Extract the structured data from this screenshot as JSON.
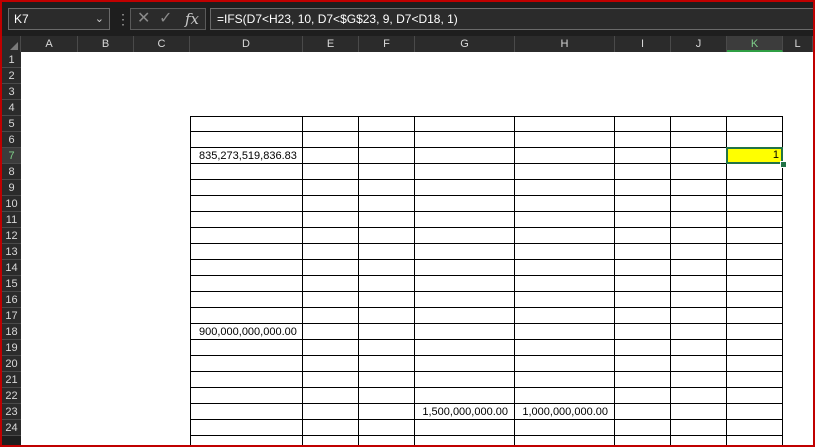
{
  "name_box": {
    "value": "K7",
    "dropdown_icon": "chevron-down-icon"
  },
  "formula_bar": {
    "cancel_icon": "cancel-x-icon",
    "enter_icon": "checkmark-icon",
    "fx_label": "fx",
    "formula": "=IFS(D7<H23, 10, D7<$G$23, 9, D7<D18, 1)"
  },
  "columns": [
    "A",
    "B",
    "C",
    "D",
    "E",
    "F",
    "G",
    "H",
    "I",
    "J",
    "K",
    "L"
  ],
  "rows": [
    "1",
    "2",
    "3",
    "4",
    "5",
    "6",
    "7",
    "8",
    "9",
    "10",
    "11",
    "12",
    "13",
    "14",
    "15",
    "16",
    "17",
    "18",
    "19",
    "20",
    "21",
    "22",
    "23",
    "24"
  ],
  "cells": {
    "D7": "835,273,519,836.83",
    "D18": "900,000,000,000.00",
    "G23": "1,500,000,000.00",
    "H23": "1,000,000,000.00",
    "K7": "1"
  },
  "selected_cell": "K7",
  "colors": {
    "selection": "#217346",
    "highlight_fill": "#ffff00",
    "frame": "#c00000"
  }
}
